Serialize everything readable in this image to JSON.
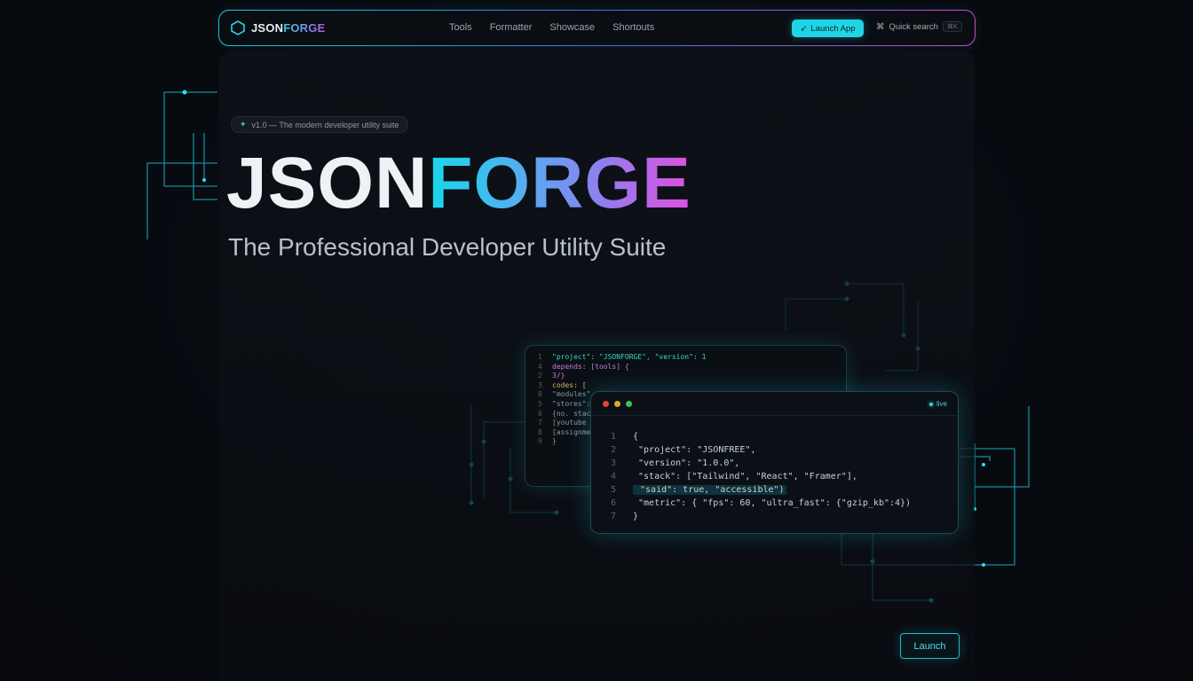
{
  "nav": {
    "brand_json": "JSON",
    "brand_forge": "FORGE",
    "links": [
      "Tools",
      "Formatter",
      "Showcase",
      "Shortouts"
    ],
    "launch_label": "Launch App",
    "search_label": "Quick search",
    "search_kbd": "⌘K"
  },
  "hero": {
    "badge": "v1.0 — The modern developer utility suite",
    "title_json": "JSON",
    "title_forge": "FORGE",
    "subtitle": "The Professional Developer Utility Suite"
  },
  "code_back": {
    "lines": [
      {
        "n": "1",
        "t": "\"project\": \"JSONFORGE\", \"version\": 1"
      },
      {
        "n": "4",
        "t": "depends: [tools] {"
      },
      {
        "n": "2",
        "t": "3/}"
      },
      {
        "n": "3",
        "t": "codes: ["
      },
      {
        "n": "8",
        "t": "\"modules\","
      },
      {
        "n": "5",
        "t": "\"stores\": ["
      },
      {
        "n": "6",
        "t": "{no. stack"
      },
      {
        "n": "7",
        "t": "[youtube"
      },
      {
        "n": "8",
        "t": "[assignments"
      },
      {
        "n": "9",
        "t": "}"
      }
    ]
  },
  "code_front": {
    "live_label": "live",
    "lines": [
      {
        "n": "1",
        "t": "{"
      },
      {
        "n": "2",
        "t": "  \"project\": \"JSONFREE\","
      },
      {
        "n": "3",
        "t": "  \"version\": \"1.0.0\","
      },
      {
        "n": "4",
        "t": "  \"stack\": [\"Tailwind\", \"React\", \"Framer\"],"
      },
      {
        "n": "5",
        "t": "  \"said\": true, \"accessible\")"
      },
      {
        "n": "6",
        "t": "  \"metric\": { \"fps\": 60, \"ultra_fast\": {\"gzip_kb\":4})"
      },
      {
        "n": "7",
        "t": "}"
      }
    ]
  },
  "cta": {
    "launch_label": "Launch"
  },
  "colors": {
    "accent_cyan": "#1fd4e6",
    "accent_magenta": "#e04fe0",
    "background": "#070a0f"
  }
}
